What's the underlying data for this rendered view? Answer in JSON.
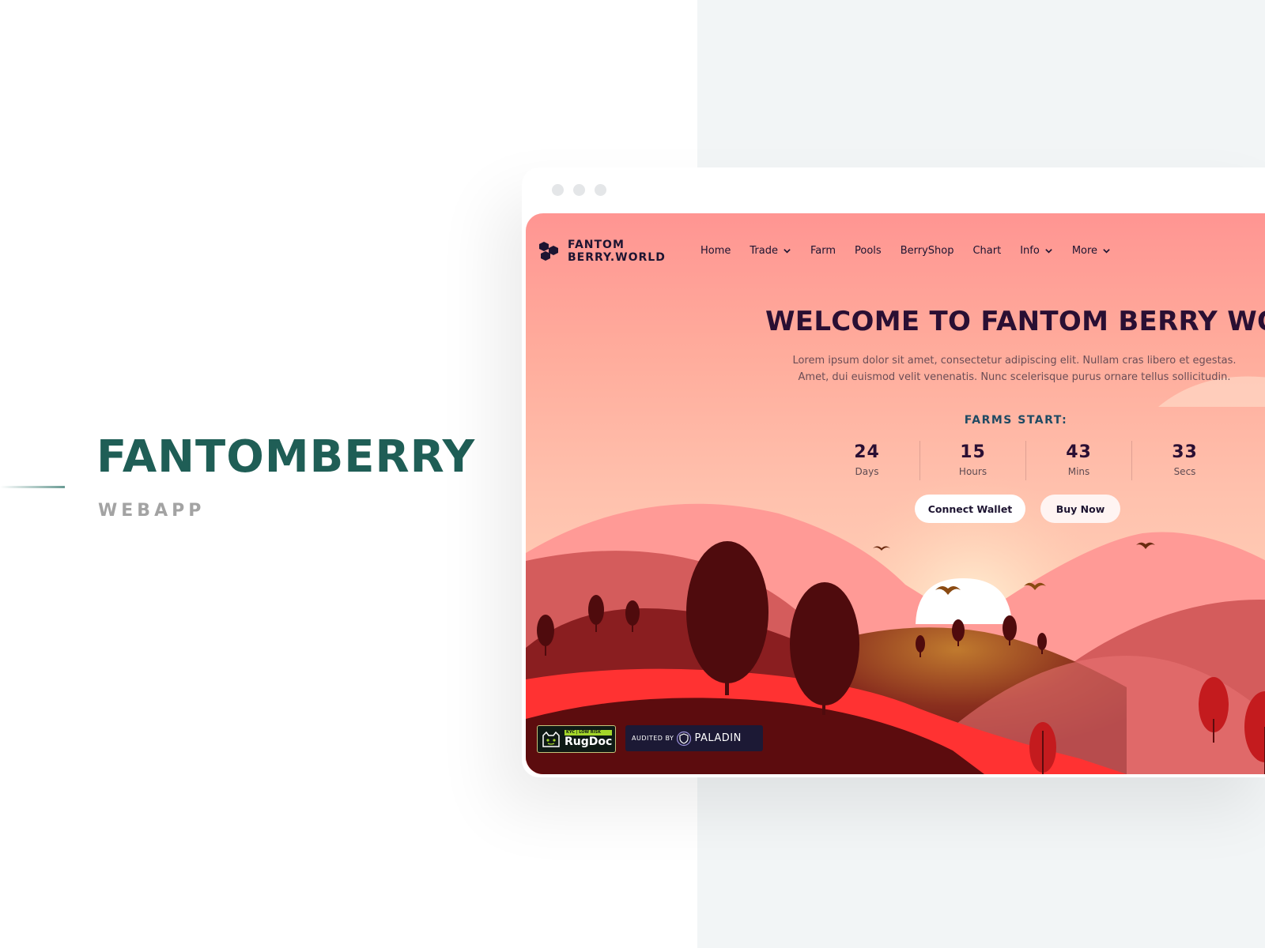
{
  "brand": {
    "title": "FANTOMBERRY",
    "subtitle": "WEBAPP",
    "color": "#1f5e56"
  },
  "site": {
    "logo": {
      "line1": "FANTOM",
      "line2": "BERRY.WORLD",
      "icon": "berry-logo-icon"
    },
    "nav": [
      {
        "label": "Home",
        "dropdown": false
      },
      {
        "label": "Trade",
        "dropdown": true
      },
      {
        "label": "Farm",
        "dropdown": false
      },
      {
        "label": "Pools",
        "dropdown": false
      },
      {
        "label": "BerryShop",
        "dropdown": false
      },
      {
        "label": "Chart",
        "dropdown": false
      },
      {
        "label": "Info",
        "dropdown": true
      },
      {
        "label": "More",
        "dropdown": true
      }
    ],
    "hero": {
      "title": "WELCOME TO FANTOM BERRY WORLD",
      "description": "Lorem ipsum dolor sit amet, consectetur adipiscing elit. Nullam cras libero et egestas. Amet, dui euismod velit venenatis. Nunc scelerisque purus ornare tellus sollicitudin."
    },
    "countdown": {
      "label": "FARMS START:",
      "units": [
        {
          "value": "24",
          "unit": "Days"
        },
        {
          "value": "15",
          "unit": "Hours"
        },
        {
          "value": "43",
          "unit": "Mins"
        },
        {
          "value": "33",
          "unit": "Secs"
        }
      ]
    },
    "buttons": {
      "connect": "Connect Wallet",
      "buy": "Buy Now"
    },
    "badges": {
      "rugdoc": {
        "tag": "KYC | LOW RISK",
        "name": "RugDoc"
      },
      "paladin": {
        "prefix": "AUDITED BY",
        "name": "PALADIN"
      }
    },
    "colors": {
      "sky_top": "#ff9592",
      "sky_bottom": "#ffd4bc",
      "hill_light": "#ff9a96",
      "hill_mid": "#d45c5c",
      "hill_dark": "#8a1e20",
      "ground_red": "#ff3232",
      "tree_dark": "#4f0b0d"
    }
  }
}
